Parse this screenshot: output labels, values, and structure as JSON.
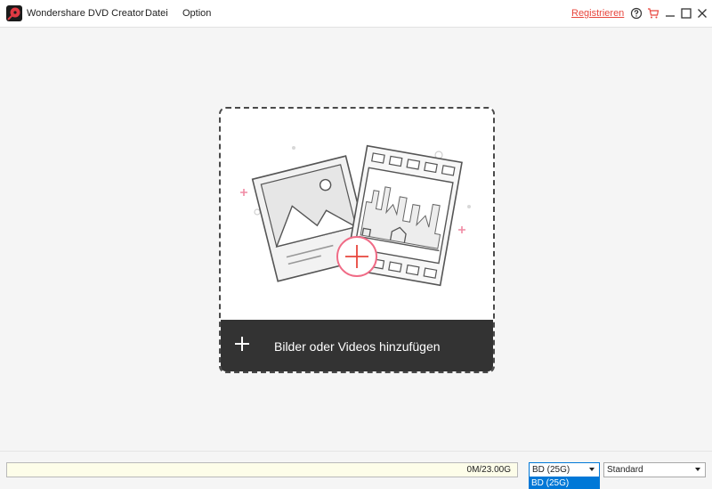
{
  "app": {
    "title": "Wondershare DVD Creator",
    "logo_icon": "wondershare-dvd-creator-logo",
    "accent_color": "#e8463d"
  },
  "menu": {
    "items": [
      {
        "label": "Datei"
      },
      {
        "label": "Option"
      }
    ]
  },
  "titlebar": {
    "register_label": "Registrieren",
    "icons": [
      "help-icon",
      "cart-icon",
      "minimize-icon",
      "maximize-icon",
      "close-icon"
    ]
  },
  "drop_area": {
    "add_label": "Bilder oder Videos hinzufügen",
    "add_icon": "plus-icon",
    "illustration_icons": [
      "photo-icon",
      "film-strip-icon",
      "add-circle-icon"
    ]
  },
  "status": {
    "capacity_text": "0M/23.00G",
    "disc_type": {
      "selected": "BD (25G)",
      "options": [
        "BD (25G)"
      ]
    },
    "quality": {
      "selected": "Standard"
    }
  }
}
